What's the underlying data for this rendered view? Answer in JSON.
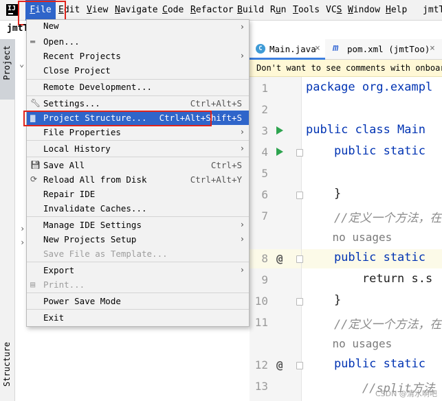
{
  "window": {
    "project_short": "jmtT"
  },
  "menubar": {
    "items": [
      {
        "pre": "",
        "mn": "F",
        "post": "ile"
      },
      {
        "pre": "",
        "mn": "E",
        "post": "dit"
      },
      {
        "pre": "",
        "mn": "V",
        "post": "iew"
      },
      {
        "pre": "",
        "mn": "N",
        "post": "avigate"
      },
      {
        "pre": "",
        "mn": "C",
        "post": "ode"
      },
      {
        "pre": "",
        "mn": "R",
        "post": "efactor"
      },
      {
        "pre": "",
        "mn": "B",
        "post": "uild"
      },
      {
        "pre": "R",
        "mn": "u",
        "post": "n"
      },
      {
        "pre": "",
        "mn": "T",
        "post": "ools"
      },
      {
        "pre": "VC",
        "mn": "S",
        "post": ""
      },
      {
        "pre": "",
        "mn": "W",
        "post": "indow"
      },
      {
        "pre": "",
        "mn": "H",
        "post": "elp"
      }
    ],
    "right_title": "jmtT"
  },
  "side": {
    "project_tab": "Project",
    "structure_tab": "Structure"
  },
  "file_menu": {
    "items": [
      {
        "label": "New",
        "shortcut": "",
        "submenu": true
      },
      {
        "label": "Open...",
        "shortcut": "",
        "icon": "folder-open-icon"
      },
      {
        "label": "Recent Projects",
        "shortcut": "",
        "submenu": true
      },
      {
        "label": "Close Project",
        "shortcut": ""
      },
      {
        "label": "Remote Development...",
        "shortcut": ""
      },
      {
        "label": "Settings...",
        "shortcut": "Ctrl+Alt+S",
        "icon": "wrench-icon"
      },
      {
        "label": "Project Structure...",
        "shortcut": "Ctrl+Alt+Shift+S",
        "icon": "folder-structure-icon",
        "selected": true
      },
      {
        "label": "File Properties",
        "shortcut": "",
        "submenu": true
      },
      {
        "label": "Local History",
        "shortcut": "",
        "submenu": true
      },
      {
        "label": "Save All",
        "shortcut": "Ctrl+S",
        "icon": "save-icon"
      },
      {
        "label": "Reload All from Disk",
        "shortcut": "Ctrl+Alt+Y",
        "icon": "reload-icon"
      },
      {
        "label": "Repair IDE",
        "shortcut": ""
      },
      {
        "label": "Invalidate Caches...",
        "shortcut": ""
      },
      {
        "label": "Manage IDE Settings",
        "shortcut": "",
        "submenu": true
      },
      {
        "label": "New Projects Setup",
        "shortcut": "",
        "submenu": true
      },
      {
        "label": "Save File as Template...",
        "shortcut": "",
        "disabled": true
      },
      {
        "label": "Export",
        "shortcut": "",
        "submenu": true
      },
      {
        "label": "Print...",
        "shortcut": "",
        "icon": "print-icon",
        "disabled": true
      },
      {
        "label": "Power Save Mode",
        "shortcut": ""
      },
      {
        "label": "Exit",
        "shortcut": ""
      }
    ]
  },
  "editor": {
    "tabs": [
      {
        "label": "Main.java",
        "icon": "java-class-icon",
        "active": true
      },
      {
        "label": "pom.xml (jmtToo)",
        "icon": "maven-icon",
        "active": false
      }
    ],
    "banner": "Don't want to see comments with onboard",
    "lines": [
      {
        "n": "1",
        "code": "package org.exampl"
      },
      {
        "n": "2",
        "code": ""
      },
      {
        "n": "3",
        "code": "public class Main "
      },
      {
        "n": "4",
        "code": "    public static "
      },
      {
        "n": "5",
        "code": ""
      },
      {
        "n": "6",
        "code": "    }"
      },
      {
        "n": "7",
        "code": "    //定义一个方法，在"
      },
      {
        "n": "",
        "code": "    no usages"
      },
      {
        "n": "8",
        "code": "    public static "
      },
      {
        "n": "9",
        "code": "        return s.s"
      },
      {
        "n": "10",
        "code": "    }"
      },
      {
        "n": "11",
        "code": "    //定义一个方法，在"
      },
      {
        "n": "",
        "code": "    no usages"
      },
      {
        "n": "12",
        "code": "    public static "
      },
      {
        "n": "13",
        "code": "        //split方法"
      }
    ]
  },
  "watermark": "CSDN @清水啊吧"
}
